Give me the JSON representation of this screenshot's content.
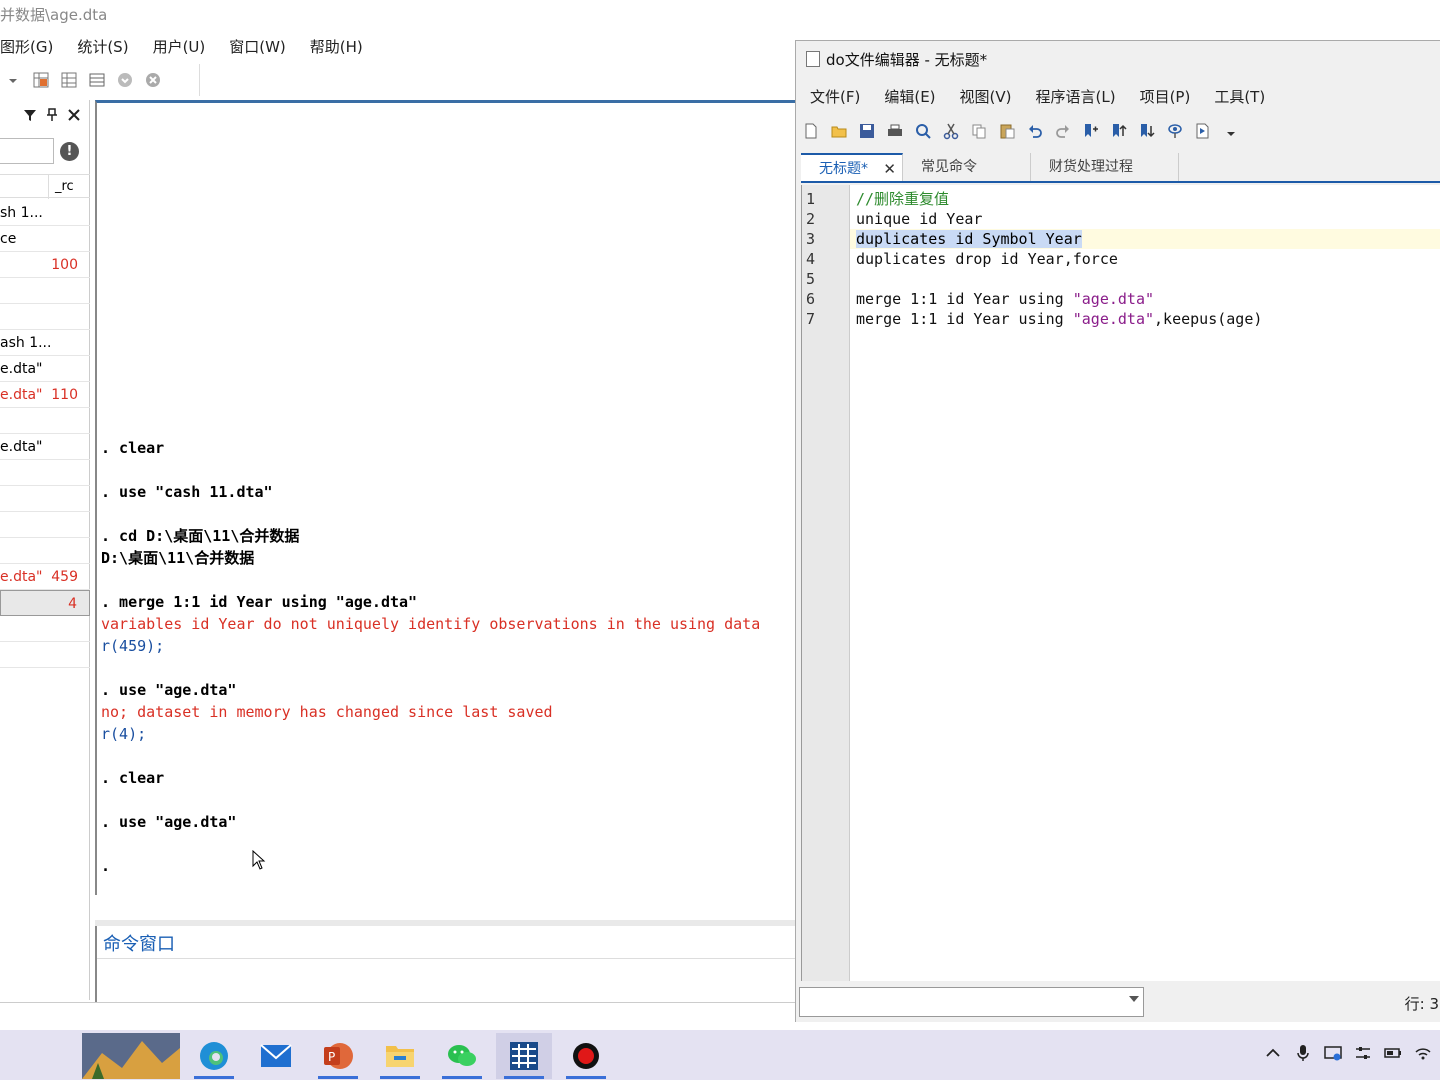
{
  "main_window": {
    "title": "并数据\\age.dta",
    "menu": [
      "图形(G)",
      "统计(S)",
      "用户(U)",
      "窗口(W)",
      "帮助(H)"
    ]
  },
  "history": {
    "col_rc": "_rc",
    "alert": "!",
    "rows": [
      {
        "cmd": "sh 1...",
        "rc": "",
        "err": false,
        "sel": false
      },
      {
        "cmd": "ce",
        "rc": "",
        "err": false,
        "sel": false
      },
      {
        "cmd": "",
        "rc": "100",
        "err": true,
        "sel": false
      },
      {
        "cmd": "",
        "rc": "",
        "err": false,
        "sel": false
      },
      {
        "cmd": "",
        "rc": "",
        "err": false,
        "sel": false
      },
      {
        "cmd": "ash 1...",
        "rc": "",
        "err": false,
        "sel": false
      },
      {
        "cmd": "e.dta\"",
        "rc": "",
        "err": false,
        "sel": false
      },
      {
        "cmd": "e.dta\"",
        "rc": "110",
        "err": true,
        "sel": false
      },
      {
        "cmd": "",
        "rc": "",
        "err": false,
        "sel": false
      },
      {
        "cmd": "e.dta\"",
        "rc": "",
        "err": false,
        "sel": false
      },
      {
        "cmd": "",
        "rc": "",
        "err": false,
        "sel": false
      },
      {
        "cmd": "",
        "rc": "",
        "err": false,
        "sel": false
      },
      {
        "cmd": "",
        "rc": "",
        "err": false,
        "sel": false
      },
      {
        "cmd": "",
        "rc": "",
        "err": false,
        "sel": false
      },
      {
        "cmd": "e.dta\"",
        "rc": "459",
        "err": true,
        "sel": false
      },
      {
        "cmd": "",
        "rc": "4",
        "err": true,
        "sel": true
      },
      {
        "cmd": "",
        "rc": "",
        "err": false,
        "sel": false
      },
      {
        "cmd": "",
        "rc": "",
        "err": false,
        "sel": false
      }
    ]
  },
  "results": {
    "lines": [
      {
        "text": ". clear",
        "kind": "cmd"
      },
      {
        "text": "",
        "kind": "out"
      },
      {
        "text": ". use \"cash 11.dta\"",
        "kind": "cmd"
      },
      {
        "text": "",
        "kind": "out"
      },
      {
        "text": ". cd D:\\桌面\\11\\合并数据",
        "kind": "cmd"
      },
      {
        "text": "D:\\桌面\\11\\合并数据",
        "kind": "out"
      },
      {
        "text": "",
        "kind": "out"
      },
      {
        "text": ". merge 1:1 id Year using \"age.dta\"",
        "kind": "cmd"
      },
      {
        "text": "variables id Year do not uniquely identify observations in the using data",
        "kind": "red"
      },
      {
        "text": "r(459);",
        "kind": "blue"
      },
      {
        "text": "",
        "kind": "out"
      },
      {
        "text": ". use \"age.dta\"",
        "kind": "cmd"
      },
      {
        "text": "no; dataset in memory has changed since last saved",
        "kind": "red"
      },
      {
        "text": "r(4);",
        "kind": "blue"
      },
      {
        "text": "",
        "kind": "out"
      },
      {
        "text": ". clear",
        "kind": "cmd"
      },
      {
        "text": "",
        "kind": "out"
      },
      {
        "text": ". use \"age.dta\"",
        "kind": "cmd"
      },
      {
        "text": "",
        "kind": "out"
      },
      {
        "text": ".",
        "kind": "cmd"
      }
    ]
  },
  "command_window": {
    "label": "命令窗口"
  },
  "editor": {
    "title": "do文件编辑器 - 无标题*",
    "menu": [
      "文件(F)",
      "编辑(E)",
      "视图(V)",
      "程序语言(L)",
      "项目(P)",
      "工具(T)"
    ],
    "tabs": [
      "无标题*",
      "常见命令",
      "财货处理过程"
    ],
    "tab_close": "✕",
    "code_lines": [
      {
        "n": "1",
        "segments": [
          {
            "t": "//删除重复值",
            "c": "cmt"
          }
        ],
        "cur": false
      },
      {
        "n": "2",
        "segments": [
          {
            "t": "unique id Year",
            "c": "plain"
          }
        ],
        "cur": false
      },
      {
        "n": "3",
        "segments": [
          {
            "t": "duplicates id Symbol Year",
            "c": "hl"
          }
        ],
        "cur": true
      },
      {
        "n": "4",
        "segments": [
          {
            "t": "duplicates drop id Year,force",
            "c": "plain"
          }
        ],
        "cur": false
      },
      {
        "n": "5",
        "segments": [
          {
            "t": "",
            "c": "plain"
          }
        ],
        "cur": false
      },
      {
        "n": "6",
        "segments": [
          {
            "t": "merge 1:1 id Year using ",
            "c": "plain"
          },
          {
            "t": "\"age.dta\"",
            "c": "str"
          }
        ],
        "cur": false
      },
      {
        "n": "7",
        "segments": [
          {
            "t": "merge 1:1 id Year using ",
            "c": "plain"
          },
          {
            "t": "\"age.dta\"",
            "c": "str"
          },
          {
            "t": ",keepus(age)",
            "c": "plain"
          }
        ],
        "cur": false
      }
    ],
    "status_pos": "行: 3"
  },
  "colors": {
    "error_red": "#d93025",
    "rc_blue": "#1a4fa0",
    "accent_blue": "#1c5aa8",
    "taskbar_bg": "#e4e2f2"
  },
  "taskbar": {
    "apps": [
      "landscape-thumbnail",
      "edge-icon",
      "mail-icon",
      "powerpoint-icon",
      "file-explorer-icon",
      "wechat-icon",
      "stata-icon",
      "record-icon"
    ]
  }
}
